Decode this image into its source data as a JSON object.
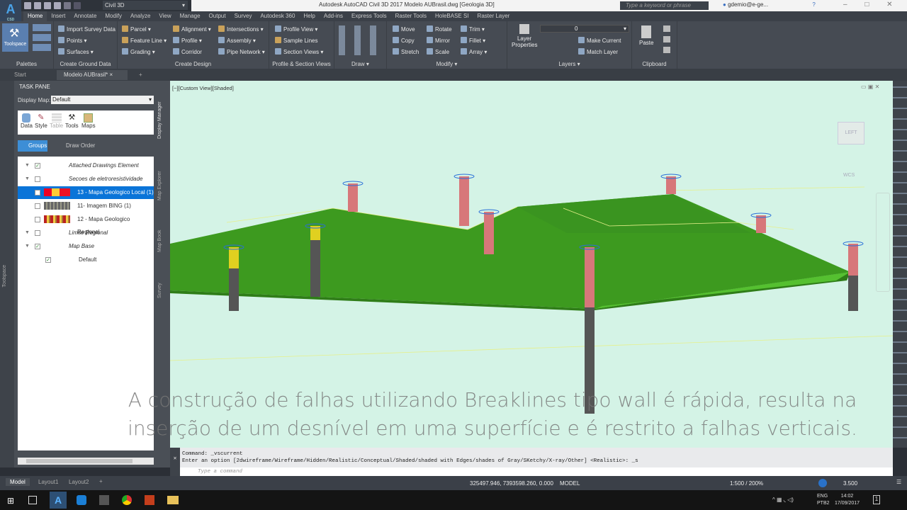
{
  "titlebar": {
    "workspace": "Civil 3D",
    "title": "Autodesk AutoCAD Civil 3D 2017   Modelo AUBrasil.dwg [Geologia 3D]",
    "search_placeholder": "Type a keyword or phrase",
    "user": "gdemio@e-ge...",
    "app_letter": "A",
    "app_sub": "CSD"
  },
  "ribbon_tabs": [
    "Home",
    "Insert",
    "Annotate",
    "Modify",
    "Analyze",
    "View",
    "Manage",
    "Output",
    "Survey",
    "Autodesk 360",
    "Help",
    "Add-ins",
    "Express Tools",
    "Raster Tools",
    "HoleBASE SI",
    "Raster Layer"
  ],
  "ribbon": {
    "palettes": {
      "label": "Palettes",
      "toolspace": "Toolspace"
    },
    "ground": {
      "label": "Create Ground Data",
      "items": [
        "Import Survey Data",
        "Points",
        "Surfaces"
      ]
    },
    "design": {
      "label": "Create Design",
      "items": [
        "Parcel",
        "Feature Line",
        "Grading",
        "Alignment",
        "Profile",
        "Corridor",
        "Intersections",
        "Assembly",
        "Pipe Network"
      ]
    },
    "profile": {
      "label": "Profile & Section Views",
      "items": [
        "Profile View",
        "Sample Lines",
        "Section Views"
      ]
    },
    "draw": {
      "label": "Draw"
    },
    "modify": {
      "label": "Modify",
      "items": [
        "Move",
        "Copy",
        "Stretch",
        "Rotate",
        "Mirror",
        "Scale",
        "Trim",
        "Fillet",
        "Array"
      ]
    },
    "layers": {
      "label": "Layers",
      "layer_properties": "Layer Properties",
      "current_layer": "0",
      "items": [
        "Make Current",
        "Match Layer"
      ]
    },
    "clipboard": {
      "label": "Clipboard",
      "paste": "Paste"
    }
  },
  "doc_tabs": [
    "Start",
    "Modelo AUBrasil*"
  ],
  "taskpane": {
    "title": "TASK PANE",
    "display_map_label": "Display Map:",
    "display_map": "Default",
    "tools": [
      "Data",
      "Style",
      "Table",
      "Tools",
      "Maps"
    ],
    "groups": "Groups",
    "draw_order": "Draw Order",
    "side_tabs": [
      "Display Manager",
      "Map Explorer",
      "Map Book",
      "Survey"
    ],
    "tree": [
      {
        "label": "Attached Drawings Element",
        "checked": true,
        "level": 0
      },
      {
        "label": "Secoes de eletroresistividade",
        "checked": false,
        "level": 0
      },
      {
        "label": "13 - Mapa Geologico Local (1)",
        "checked": false,
        "level": 1,
        "selected": true
      },
      {
        "label": "11- Imagem BING (1)",
        "checked": false,
        "level": 1
      },
      {
        "label": "12 - Mapa Geologico Regional",
        "checked": false,
        "level": 1
      },
      {
        "label": "Limite Regional",
        "checked": false,
        "level": 0
      },
      {
        "label": "Map Base",
        "checked": true,
        "level": 0
      },
      {
        "label": "Default",
        "checked": true,
        "level": 2
      }
    ]
  },
  "left_strip": "Toolspace",
  "viewport": {
    "label": "[−][Custom View][Shaded]",
    "viewcube": "LEFT",
    "wcs": "WCS"
  },
  "subtitle": [
    "A construção de falhas utilizando Breaklines tipo wall é rápida, resulta na",
    "inserção de um desnível em uma superfície e é restrito a falhas verticais."
  ],
  "command": {
    "line1": "Command: _vscurrent",
    "line2": "Enter an option [2dwireframe/Wireframe/Hidden/Realistic/Conceptual/Shaded/shaded with Edges/shades of Gray/SKetchy/X-ray/Other] <Realistic>: _s",
    "placeholder": "Type a command"
  },
  "status": {
    "layout_tabs": [
      "Model",
      "Layout1",
      "Layout2"
    ],
    "coords": "325497.946, 7393598.260, 0.000",
    "model": "MODEL",
    "scale": "1:500 / 200%",
    "value": "3.500"
  },
  "taskbar": {
    "lang": "ENG",
    "kbd": "PTB2",
    "time": "14:02",
    "date": "17/09/2017",
    "notif": "1"
  }
}
